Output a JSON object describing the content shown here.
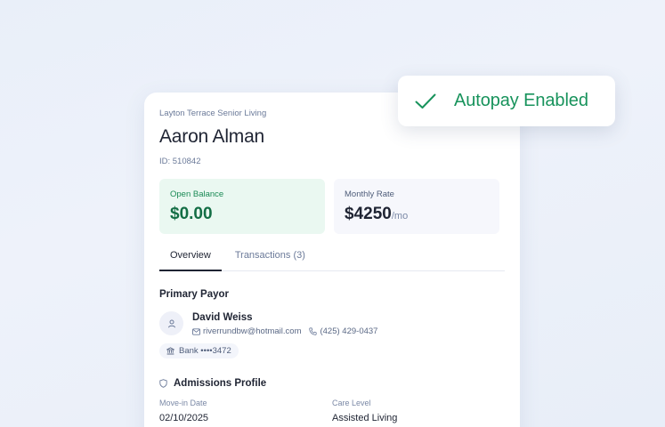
{
  "resident": {
    "facility": "Layton Terrace Senior Living",
    "name": "Aaron Alman",
    "id_text": "ID: 510842"
  },
  "stats": {
    "balance_label": "Open Balance",
    "balance_value": "$0.00",
    "rate_label": "Monthly Rate",
    "rate_value": "$4250",
    "rate_unit": "/mo"
  },
  "tabs": [
    {
      "label": "Overview",
      "active": true
    },
    {
      "label": "Transactions (3)",
      "active": false
    }
  ],
  "payor": {
    "section_title": "Primary Payor",
    "name": "David Weiss",
    "email": "riverrundbw@hotmail.com",
    "phone": "(425) 429-0437",
    "bank": "Bank ••••3472"
  },
  "admissions": {
    "section_title": "Admissions Profile",
    "move_in_label": "Move-in Date",
    "move_in_value": "02/10/2025",
    "care_label": "Care Level",
    "care_value": "Assisted Living"
  },
  "toast": {
    "label": "Autopay Enabled",
    "icon": "check-icon"
  },
  "colors": {
    "accent_green": "#18935c",
    "balance_bg": "#eaf8f1",
    "text_primary": "#1f2433",
    "text_muted": "#6b7a99"
  }
}
